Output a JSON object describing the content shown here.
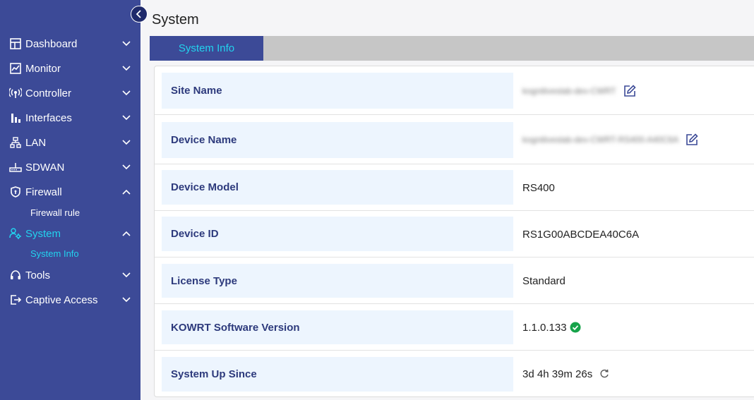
{
  "page": {
    "title": "System"
  },
  "sidebar": {
    "items": [
      {
        "label": "Dashboard",
        "icon": "dashboard-icon",
        "expanded": false
      },
      {
        "label": "Monitor",
        "icon": "monitor-icon",
        "expanded": false
      },
      {
        "label": "Controller",
        "icon": "controller-icon",
        "expanded": false
      },
      {
        "label": "Interfaces",
        "icon": "interfaces-icon",
        "expanded": false
      },
      {
        "label": "LAN",
        "icon": "lan-icon",
        "expanded": false
      },
      {
        "label": "SDWAN",
        "icon": "sdwan-icon",
        "expanded": false
      },
      {
        "label": "Firewall",
        "icon": "firewall-icon",
        "expanded": true,
        "children": [
          "Firewall rule"
        ]
      },
      {
        "label": "System",
        "icon": "system-icon",
        "expanded": true,
        "active": true,
        "children": [
          "System Info"
        ]
      },
      {
        "label": "Tools",
        "icon": "tools-icon",
        "expanded": false
      },
      {
        "label": "Captive Access",
        "icon": "captive-access-icon",
        "expanded": false
      }
    ]
  },
  "tabs": [
    {
      "label": "System Info",
      "active": true
    }
  ],
  "info": {
    "rows": [
      {
        "key": "Site Name",
        "value": "kognitiveslab-dev-CWRT",
        "blurred": true,
        "editable": true
      },
      {
        "key": "Device Name",
        "value": "kognitiveslab-dev-CWRT-RS400-A40C6A",
        "blurred": true,
        "editable": true
      },
      {
        "key": "Device Model",
        "value": "RS400"
      },
      {
        "key": "Device ID",
        "value": "RS1G00ABCDEA40C6A"
      },
      {
        "key": "License Type",
        "value": "Standard"
      },
      {
        "key": "KOWRT Software Version",
        "value": "1.1.0.133"
      },
      {
        "key": "System Up Since",
        "value": "3d 4h 39m 26s"
      }
    ]
  },
  "colors": {
    "sidebar_bg": "#3c4a97",
    "accent": "#22d3ee",
    "key_bg": "#edf5fe",
    "key_text": "#2d3a7c",
    "ok_green": "#16a34a"
  }
}
